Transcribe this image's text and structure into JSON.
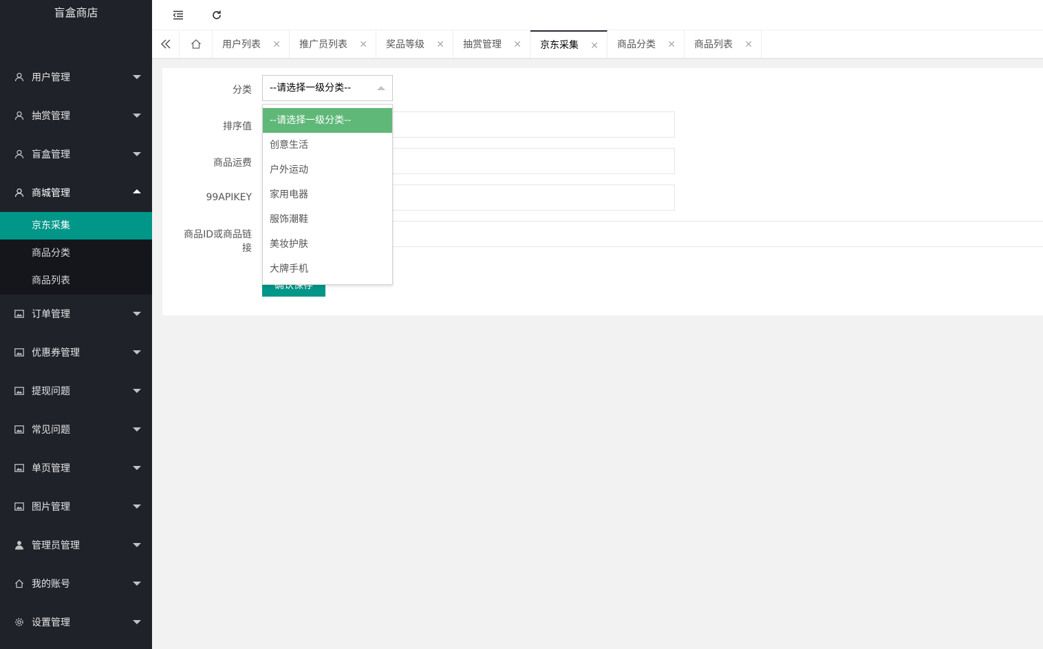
{
  "app": {
    "title": "盲盒商店"
  },
  "sidebar": {
    "items": [
      {
        "label": "用户管理",
        "icon": "user-icon"
      },
      {
        "label": "抽赏管理",
        "icon": "user-icon"
      },
      {
        "label": "盲盒管理",
        "icon": "user-icon"
      },
      {
        "label": "商城管理",
        "icon": "user-icon",
        "expanded": true
      },
      {
        "label": "订单管理",
        "icon": "picture-icon"
      },
      {
        "label": "优惠券管理",
        "icon": "picture-icon"
      },
      {
        "label": "提现问题",
        "icon": "picture-icon"
      },
      {
        "label": "常见问题",
        "icon": "picture-icon"
      },
      {
        "label": "单页管理",
        "icon": "picture-icon"
      },
      {
        "label": "图片管理",
        "icon": "picture-icon"
      },
      {
        "label": "管理员管理",
        "icon": "person-icon"
      },
      {
        "label": "我的账号",
        "icon": "home-icon"
      },
      {
        "label": "设置管理",
        "icon": "gear-icon"
      }
    ],
    "subitems": [
      {
        "label": "京东采集",
        "active": true
      },
      {
        "label": "商品分类"
      },
      {
        "label": "商品列表"
      }
    ]
  },
  "tabs": [
    {
      "label": "用户列表"
    },
    {
      "label": "推广员列表"
    },
    {
      "label": "奖品等级"
    },
    {
      "label": "抽赏管理"
    },
    {
      "label": "京东采集",
      "active": true
    },
    {
      "label": "商品分类"
    },
    {
      "label": "商品列表"
    }
  ],
  "form": {
    "category_label": "分类",
    "category_value": "--请选择一级分类--",
    "sort_label": "排序值",
    "shipping_label": "商品运费",
    "apikey_label": "99APIKEY",
    "product_label_line1": "商品ID或商品链",
    "product_label_line2": "接",
    "submit_label": "确认保存"
  },
  "dropdown": {
    "options": [
      "--请选择一级分类--",
      "创意生活",
      "户外运动",
      "家用电器",
      "服饰潮鞋",
      "美妆护肤",
      "大牌手机"
    ],
    "selected_index": 0
  },
  "colors": {
    "sidebar_bg": "#20222a",
    "active_sub": "#009688",
    "dropdown_selected": "#5fb878"
  }
}
